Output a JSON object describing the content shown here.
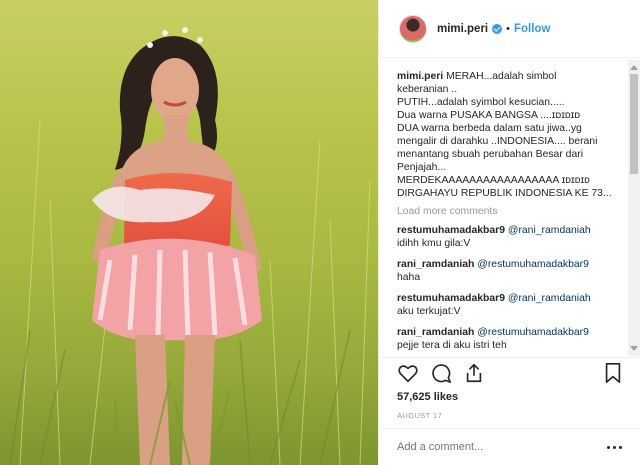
{
  "post": {
    "username": "mimi.peri",
    "follow_label": "Follow",
    "separator": "•"
  },
  "caption": {
    "username": "mimi.peri",
    "lines": [
      "MERAH...adalah simbol",
      "keberanian ..",
      "PUTIH...adalah syimbol kesucian.....",
      "Dua warna PUSAKA BANGSA ....ɪᴅɪᴅɪᴅ",
      "DUA warna berbeda dalam satu jiwa..yg",
      "mengalir di darahku ..INDONESIA.... berani",
      "menantang sbuah perubahan Besar dari",
      "Penjajah...",
      "MERDEKAAAAAAAAAAAAAAAAA ɪᴅɪᴅɪᴅ",
      "DIRGAHAYU REPUBLIK INDONESIA KE 73..."
    ]
  },
  "load_more": "Load more comments",
  "comments": [
    {
      "user": "restumuhamadakbar9",
      "mention": "@rani_ramdaniah",
      "text": "idihh kmu gila:V"
    },
    {
      "user": "rani_ramdaniah",
      "mention": "@restumuhamadakbar9",
      "text": "haha"
    },
    {
      "user": "restumuhamadakbar9",
      "mention": "@rani_ramdaniah",
      "text": "aku terkujat:V"
    },
    {
      "user": "rani_ramdaniah",
      "mention": "@restumuhamadakbar9",
      "text": "pejje tera di aku istri teh"
    }
  ],
  "stats": {
    "likes": "57,625 likes",
    "date": "AUGUST 17"
  },
  "add_comment_placeholder": "Add a comment...",
  "icons": {
    "like": "heart-icon",
    "comment": "comment-bubble-icon",
    "share": "share-icon",
    "save": "bookmark-icon",
    "more": "more-options-icon",
    "verified": "verified-badge-icon"
  },
  "colors": {
    "link": "#3897f0",
    "muted": "#999999",
    "text": "#262626"
  }
}
